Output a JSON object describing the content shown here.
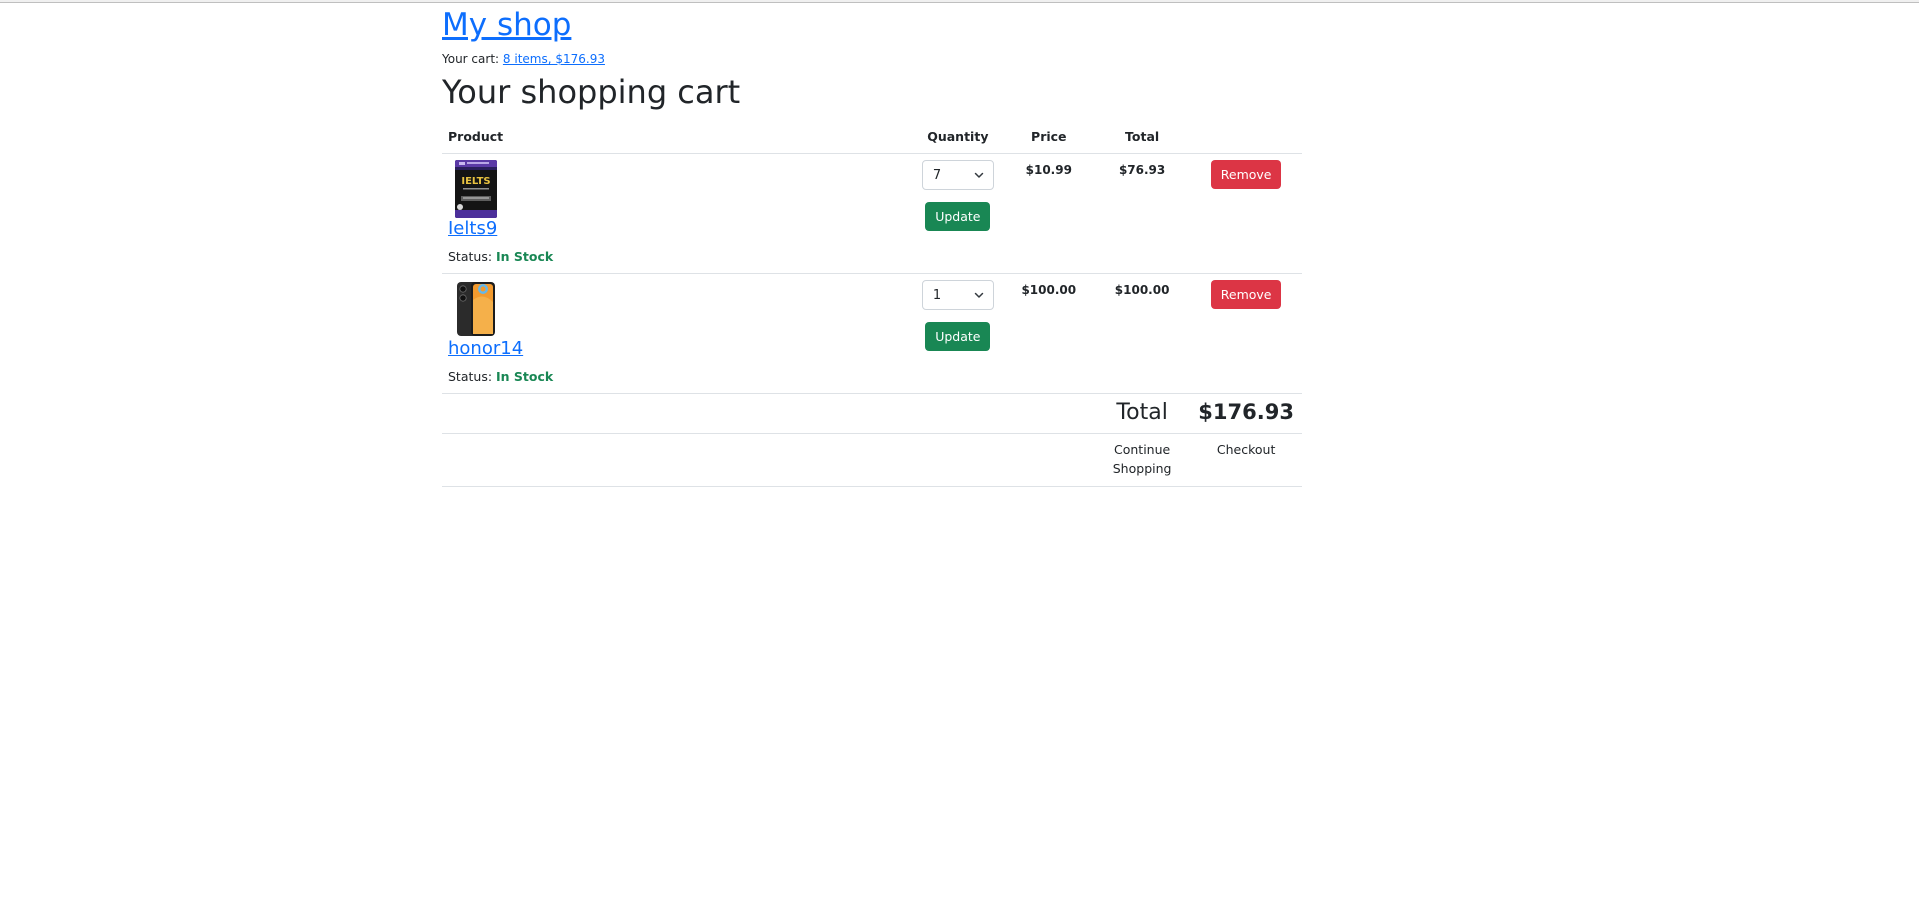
{
  "header": {
    "site_title": "My shop",
    "cart_label": "Your cart:",
    "cart_link": "8 items, $176.93"
  },
  "page_title": "Your shopping cart",
  "table": {
    "headers": {
      "product": "Product",
      "quantity": "Quantity",
      "price": "Price",
      "total": "Total"
    },
    "rows": [
      {
        "name": "Ielts9",
        "status_label": "Status:",
        "status": "In Stock",
        "quantity": "7",
        "update_label": "Update",
        "price": "$10.99",
        "total": "$76.93",
        "remove_label": "Remove",
        "thumbnail_icon": "book-cover-icon",
        "thumbnail_text": "IELTS"
      },
      {
        "name": "honor14",
        "status_label": "Status:",
        "status": "In Stock",
        "quantity": "1",
        "update_label": "Update",
        "price": "$100.00",
        "total": "$100.00",
        "remove_label": "Remove",
        "thumbnail_icon": "smartphone-icon"
      }
    ],
    "grand_total_label": "Total",
    "grand_total_value": "$176.93",
    "continue_shopping": "Continue Shopping",
    "checkout": "Checkout"
  },
  "colors": {
    "link": "#0d6efd",
    "update_button": "#198754",
    "remove_button": "#dc3545",
    "in_stock": "#198754"
  }
}
